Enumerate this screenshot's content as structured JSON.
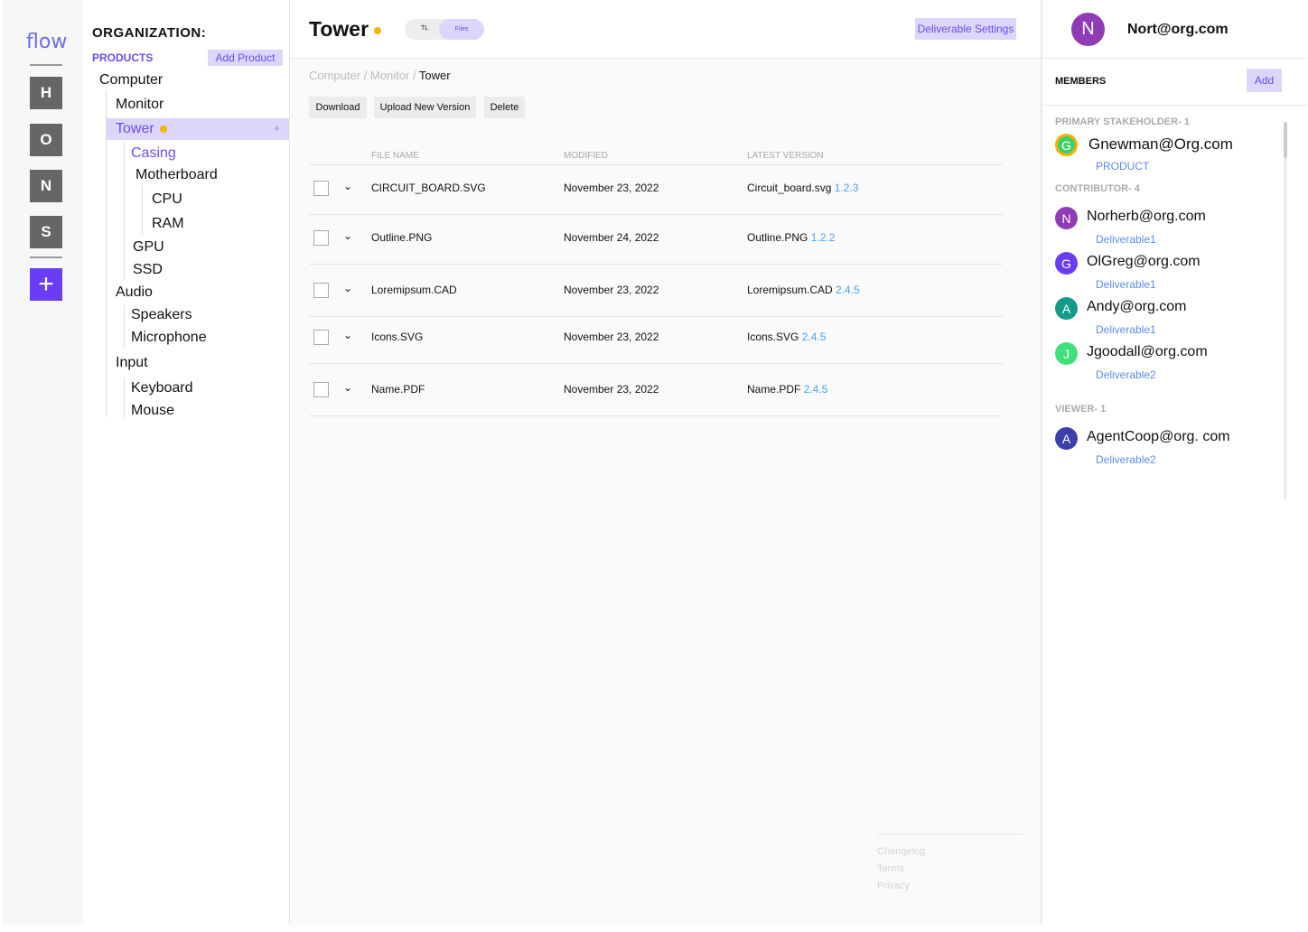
{
  "rail": {
    "logo": "flow",
    "items": [
      "H",
      "O",
      "N",
      "S"
    ],
    "add": "+"
  },
  "tree": {
    "org_label": "ORGANIZATION:",
    "products_label": "PRODUCTS",
    "add_product": "Add Product",
    "items": [
      "Computer",
      "Monitor",
      "Tower",
      "Casing",
      "Motherboard",
      "CPU",
      "RAM",
      "GPU",
      "SSD",
      "Audio",
      "Speakers",
      "Microphone",
      "Input",
      "Keyboard",
      "Mouse"
    ],
    "tower_add": "+"
  },
  "header": {
    "title": "Tower",
    "toggle_tl": "TL",
    "toggle_files": "Files",
    "settings": "Deliverable Settings"
  },
  "breadcrumb": {
    "parts": [
      "Computer",
      "Monitor"
    ],
    "current": "Tower",
    "sep": " / "
  },
  "toolbar": {
    "download": "Download",
    "upload": "Upload New Version",
    "delete": "Delete"
  },
  "table": {
    "headers": [
      "FILE NAME",
      "MODIFIED",
      "LATEST VERSION"
    ],
    "rows": [
      {
        "name": "CIRCUIT_BOARD.SVG",
        "modified": "November 23, 2022",
        "latest": "Circuit_board.svg",
        "version": "1.2.3"
      },
      {
        "name": "Outline.PNG",
        "modified": "November 24, 2022",
        "latest": "Outline.PNG",
        "version": "1.2.2"
      },
      {
        "name": "Loremipsum.CAD",
        "modified": "November 23, 2022",
        "latest": "Loremipsum.CAD",
        "version": "2.4.5"
      },
      {
        "name": "Icons.SVG",
        "modified": "November 23, 2022",
        "latest": "Icons.SVG",
        "version": "2.4.5"
      },
      {
        "name": "Name.PDF",
        "modified": "November 23, 2022",
        "latest": "Name.PDF",
        "version": "2.4.5"
      }
    ]
  },
  "footer": {
    "changelog": "Changelog",
    "terms": "Terms",
    "privacy": "Privacy"
  },
  "user": {
    "initial": "N",
    "email": "Nort@org.com"
  },
  "members": {
    "title": "MEMBERS",
    "add": "Add",
    "primary_label": "PRIMARY STAKEHOLDER- 1",
    "contrib_label": "CONTRIBUTOR- 4",
    "viewer_label": "VIEWER- 1",
    "list": [
      {
        "initial": "G",
        "email": "Gnewman@Org.com",
        "role": "PRODUCT",
        "color": "#3fcf6a"
      },
      {
        "initial": "N",
        "email": "Norherb@org.com",
        "role": "Deliverable1",
        "color": "#8e3bb5"
      },
      {
        "initial": "G",
        "email": "OlGreg@org.com",
        "role": "Deliverable1",
        "color": "#6a3df5"
      },
      {
        "initial": "A",
        "email": "Andy@org.com",
        "role": "Deliverable1",
        "color": "#149a88"
      },
      {
        "initial": "J",
        "email": "Jgoodall@org.com",
        "role": "Deliverable2",
        "color": "#3fe07a"
      },
      {
        "initial": "A",
        "email": "AgentCoop@org. com",
        "role": "Deliverable2",
        "color": "#3c3fa8"
      }
    ]
  }
}
